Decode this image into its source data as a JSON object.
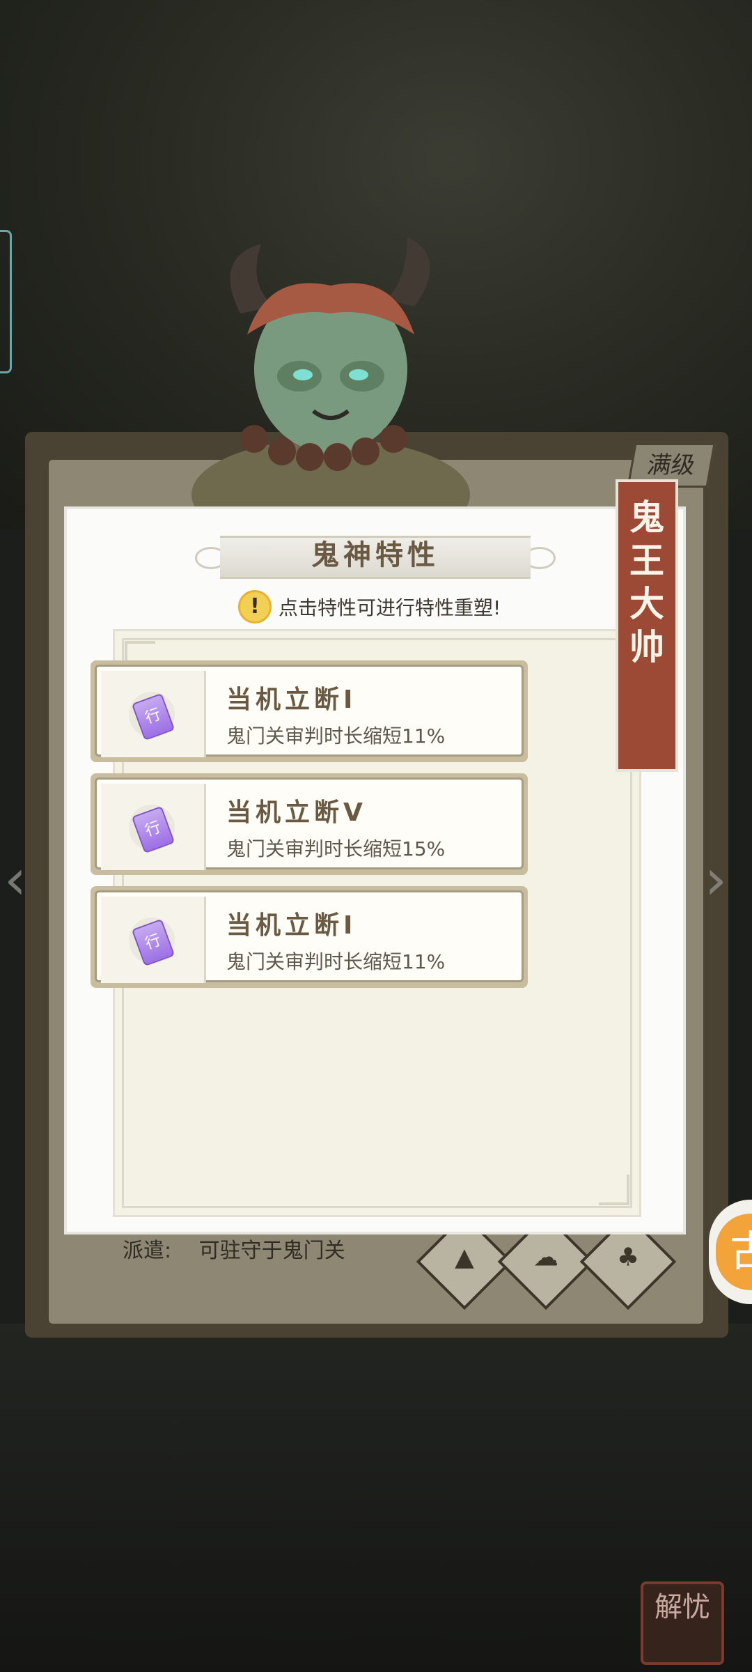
{
  "background": {
    "book_badge": "满级",
    "dispatch_label": "派遣:",
    "dispatch_value": "可驻守于鬼门关",
    "seal_text": "解忧",
    "orange_button_glyph": "古",
    "left_arrow_glyph": "‹",
    "right_arrow_glyph": "›",
    "ability_icons": [
      "camp-icon",
      "cloud-icon",
      "gourd-icon"
    ]
  },
  "modal": {
    "title": "鬼神特性",
    "hint_icon": "!",
    "hint": "点击特性可进行特性重塑!",
    "character_name": "鬼王大帅",
    "traits": [
      {
        "name": "当机立断Ⅰ",
        "desc": "鬼门关审判时长缩短11%",
        "token": "行"
      },
      {
        "name": "当机立断Ⅴ",
        "desc": "鬼门关审判时长缩短15%",
        "token": "行"
      },
      {
        "name": "当机立断Ⅰ",
        "desc": "鬼门关审判时长缩短11%",
        "token": "行"
      }
    ]
  },
  "colors": {
    "accent": "#9c4a36",
    "title_text": "#6b5a43",
    "token": "#9d70e6"
  }
}
